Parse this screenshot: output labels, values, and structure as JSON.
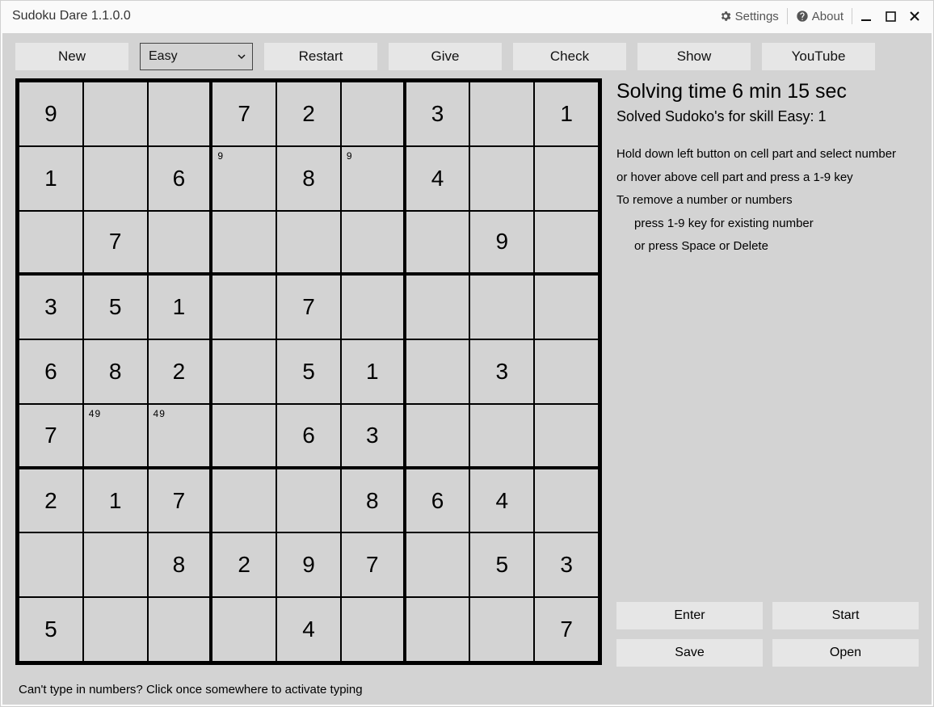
{
  "title": "Sudoku Dare 1.1.0.0",
  "titlebar": {
    "settings": "Settings",
    "about": "About"
  },
  "toolbar": {
    "new": "New",
    "difficulty_selected": "Easy",
    "restart": "Restart",
    "give": "Give",
    "check": "Check",
    "show": "Show",
    "youtube": "YouTube"
  },
  "side": {
    "solving_time": "Solving time 6 min 15 sec",
    "solved_count": "Solved Sudoko's for skill Easy: 1",
    "hint1": "Hold down left button on cell part and select number",
    "hint2": "or hover above cell part and press a 1-9 key",
    "hint3": "To remove a number or numbers",
    "hint3a": "press 1-9 key for existing number",
    "hint3b": "or press Space or Delete",
    "enter": "Enter",
    "start": "Start",
    "save": "Save",
    "open": "Open"
  },
  "footer": "Can't type in numbers? Click once somewhere to activate typing",
  "grid": [
    [
      {
        "v": "9"
      },
      {
        "v": ""
      },
      {
        "v": ""
      },
      {
        "v": "7"
      },
      {
        "v": "2"
      },
      {
        "v": ""
      },
      {
        "v": "3"
      },
      {
        "v": ""
      },
      {
        "v": "1"
      }
    ],
    [
      {
        "v": "1"
      },
      {
        "v": ""
      },
      {
        "v": "6"
      },
      {
        "v": "",
        "p": "9"
      },
      {
        "v": "8"
      },
      {
        "v": "",
        "p": "9"
      },
      {
        "v": "4"
      },
      {
        "v": ""
      },
      {
        "v": ""
      }
    ],
    [
      {
        "v": ""
      },
      {
        "v": "7"
      },
      {
        "v": ""
      },
      {
        "v": ""
      },
      {
        "v": ""
      },
      {
        "v": ""
      },
      {
        "v": ""
      },
      {
        "v": "9"
      },
      {
        "v": ""
      }
    ],
    [
      {
        "v": "3"
      },
      {
        "v": "5"
      },
      {
        "v": "1"
      },
      {
        "v": ""
      },
      {
        "v": "7"
      },
      {
        "v": ""
      },
      {
        "v": ""
      },
      {
        "v": ""
      },
      {
        "v": ""
      }
    ],
    [
      {
        "v": "6"
      },
      {
        "v": "8"
      },
      {
        "v": "2"
      },
      {
        "v": ""
      },
      {
        "v": "5"
      },
      {
        "v": "1"
      },
      {
        "v": ""
      },
      {
        "v": "3"
      },
      {
        "v": ""
      }
    ],
    [
      {
        "v": "7"
      },
      {
        "v": "",
        "p": "49"
      },
      {
        "v": "",
        "p": "49"
      },
      {
        "v": ""
      },
      {
        "v": "6"
      },
      {
        "v": "3"
      },
      {
        "v": ""
      },
      {
        "v": ""
      },
      {
        "v": ""
      }
    ],
    [
      {
        "v": "2"
      },
      {
        "v": "1"
      },
      {
        "v": "7"
      },
      {
        "v": ""
      },
      {
        "v": ""
      },
      {
        "v": "8"
      },
      {
        "v": "6"
      },
      {
        "v": "4"
      },
      {
        "v": ""
      }
    ],
    [
      {
        "v": ""
      },
      {
        "v": ""
      },
      {
        "v": "8"
      },
      {
        "v": "2"
      },
      {
        "v": "9"
      },
      {
        "v": "7"
      },
      {
        "v": ""
      },
      {
        "v": "5"
      },
      {
        "v": "3"
      }
    ],
    [
      {
        "v": "5"
      },
      {
        "v": ""
      },
      {
        "v": ""
      },
      {
        "v": ""
      },
      {
        "v": "4"
      },
      {
        "v": ""
      },
      {
        "v": ""
      },
      {
        "v": ""
      },
      {
        "v": "7"
      }
    ]
  ]
}
